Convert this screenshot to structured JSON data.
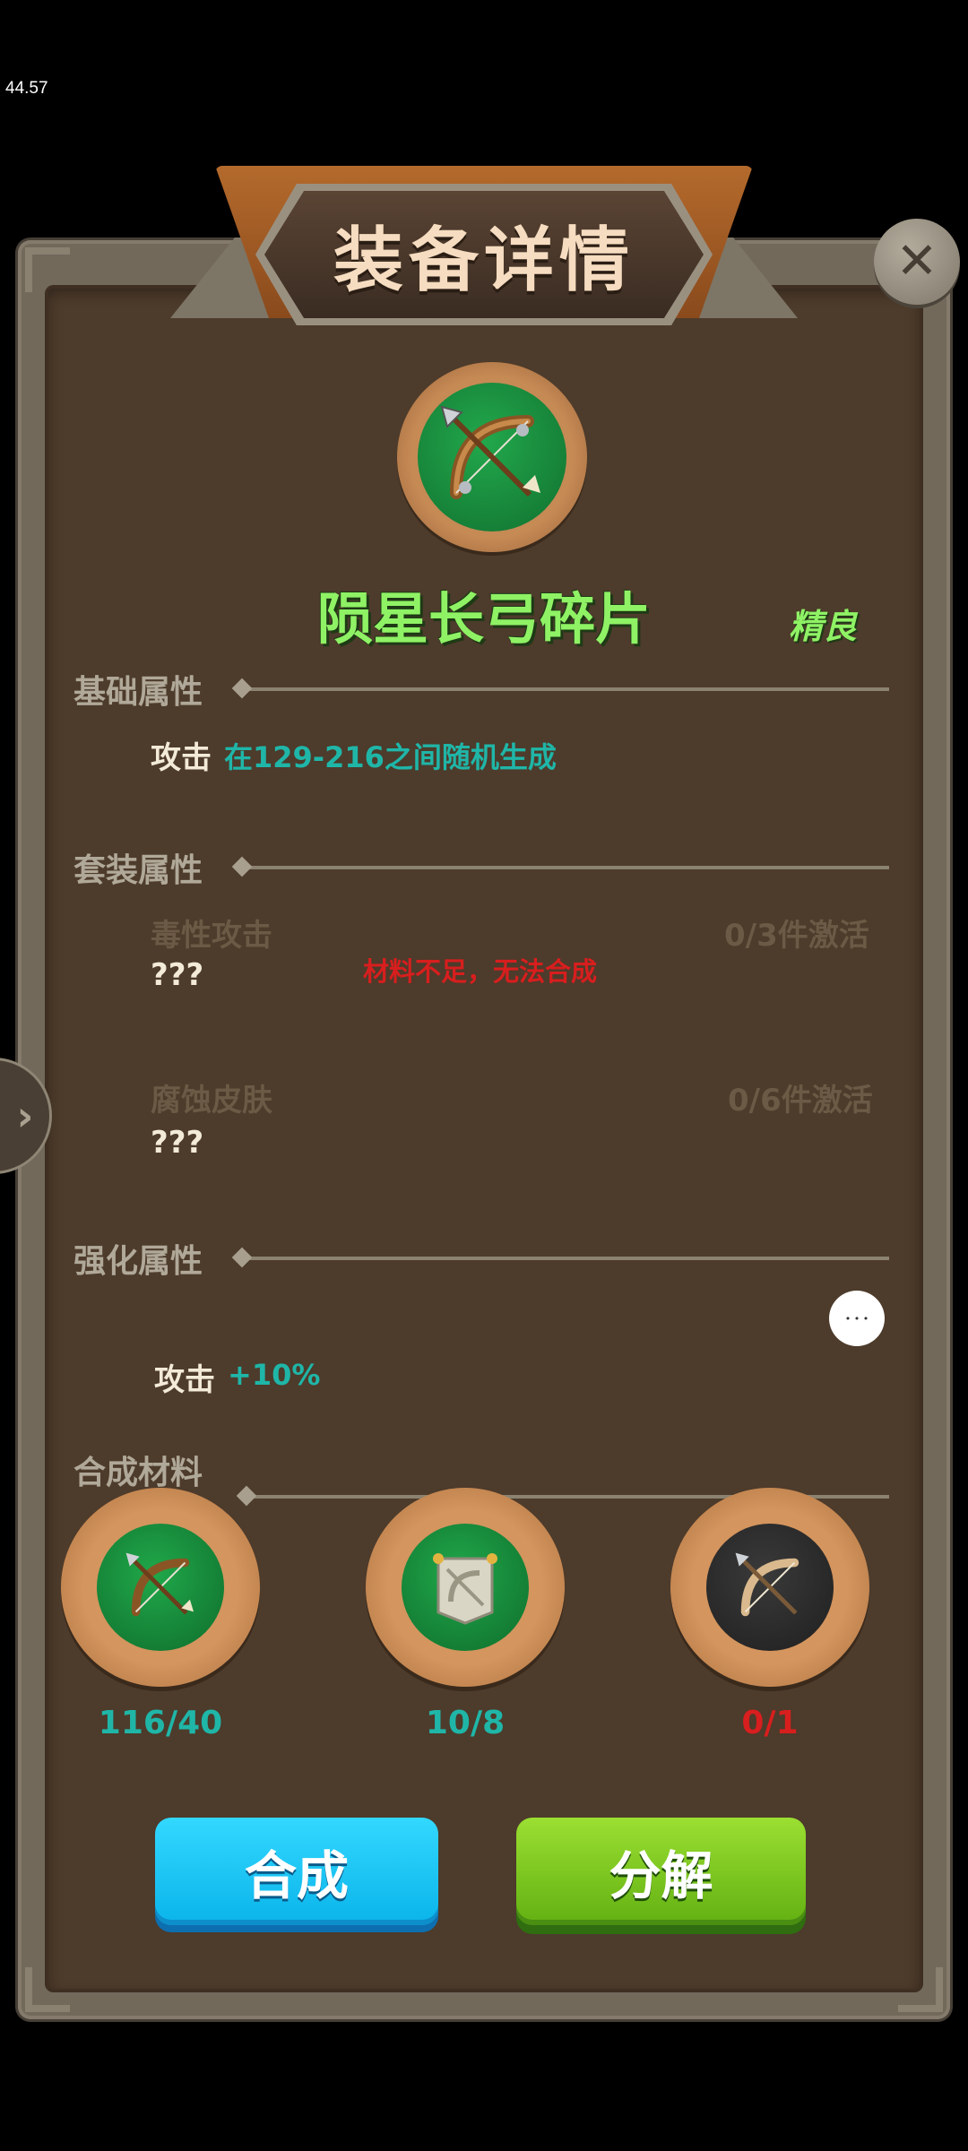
{
  "status": {
    "fps": "44.57"
  },
  "header": {
    "title": "装备详情"
  },
  "item": {
    "name": "陨星长弓碎片",
    "quality": "精良",
    "icon": "bow-icon"
  },
  "basic_attributes": {
    "label": "基础属性",
    "stat_name": "攻击",
    "stat_value": "在129-216之间随机生成"
  },
  "set_attributes": {
    "label": "套装属性",
    "sets": [
      {
        "name": "毒性攻击",
        "progress": "0/3件激活",
        "effect": "???"
      },
      {
        "name": "腐蚀皮肤",
        "progress": "0/6件激活",
        "effect": "???"
      }
    ],
    "warning": "材料不足，无法合成"
  },
  "enhance_attributes": {
    "label": "强化属性",
    "stat_name": "攻击",
    "stat_value": "+10%"
  },
  "materials": {
    "label": "合成材料",
    "items": [
      {
        "icon": "bow-icon",
        "count": "116/40",
        "count_color": "#1fb6a8"
      },
      {
        "icon": "bow-banner-icon",
        "count": "10/8",
        "count_color": "#1fb6a8"
      },
      {
        "icon": "bow-icon",
        "count": "0/1",
        "count_color": "#d81e1e"
      }
    ]
  },
  "buttons": {
    "synthesize": "合成",
    "decompose": "分解"
  },
  "colors": {
    "accent_green": "#8ff265",
    "teal": "#1fb6a8",
    "warn_red": "#d81e1e"
  }
}
